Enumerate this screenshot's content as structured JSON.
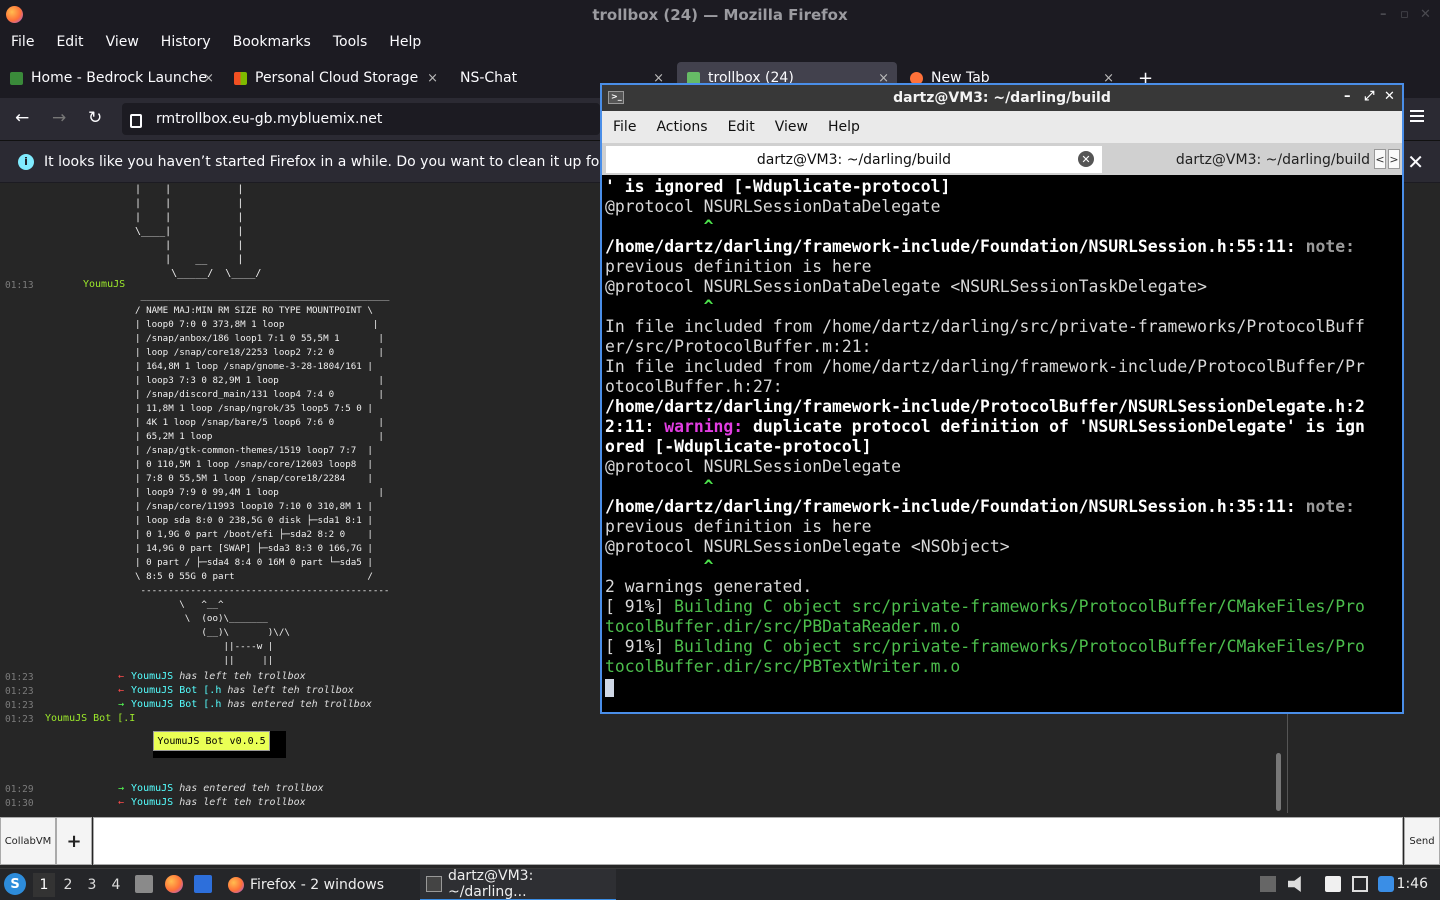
{
  "firefox": {
    "window_title": "trollbox (24) — Mozilla Firefox",
    "menu": [
      "File",
      "Edit",
      "View",
      "History",
      "Bookmarks",
      "Tools",
      "Help"
    ],
    "tabs": [
      {
        "label": "Home - Bedrock Launche",
        "close": "×"
      },
      {
        "label": "Personal Cloud Storage",
        "close": "×"
      },
      {
        "label": "NS-Chat",
        "close": "×"
      },
      {
        "label": "trollbox (24)",
        "close": "×"
      },
      {
        "label": "New Tab",
        "close": "×"
      }
    ],
    "new_tab": "+",
    "url": "rmtrollbox.eu-gb.mybluemix.net",
    "notification": "It looks like you haven’t started Firefox in a while. Do you want to clean it up for a fresh, like-new experience?",
    "notification_close": "✕",
    "nav": {
      "back": "←",
      "forward": "→",
      "reload": "↻"
    },
    "window_controls": [
      "–",
      "▫",
      "✕"
    ]
  },
  "trollbox": {
    "ascii_top": "|    |           |\n|    |           |\n|    |           |\n\\____|           |\n     |           |\n     |    __     |\n      \\_____/  \\____/",
    "ascii_df": " _____________________________________________\n/ NAME MAJ:MIN RM SIZE RO TYPE MOUNTPOINT \\\n| loop0 7:0 0 373,8M 1 loop                |\n| /snap/anbox/186 loop1 7:1 0 55,5M 1       |\n| loop /snap/core18/2253 loop2 7:2 0        |\n| 164,8M 1 loop /snap/gnome-3-28-1804/161 |\n| loop3 7:3 0 82,9M 1 loop                  |\n| /snap/discord_main/131 loop4 7:4 0        |\n| 11,8M 1 loop /snap/ngrok/35 loop5 7:5 0 |\n| 4K 1 loop /snap/bare/5 loop6 7:6 0        |\n| 65,2M 1 loop                              |\n| /snap/gtk-common-themes/1519 loop7 7:7  |\n| 0 110,5M 1 loop /snap/core/12603 loop8  |\n| 7:8 0 55,5M 1 loop /snap/core18/2284    |\n| loop9 7:9 0 99,4M 1 loop                  |\n| /snap/core/11993 loop10 7:10 0 310,8M 1 |\n| loop sda 8:0 0 238,5G 0 disk ├─sda1 8:1 |\n| 0 1,9G 0 part /boot/efi ├─sda2 8:2 0    |\n| 14,9G 0 part [SWAP] ├─sda3 8:3 0 166,7G |\n| 0 part / ├─sda4 8:4 0 16M 0 part └─sda5 |\n\\ 8:5 0 55G 0 part                        /\n ---------------------------------------------\n        \\   ^__^\n         \\  (oo)\\_______\n            (__)\\       )\\/\\\n                ||----w |\n                ||     ||",
    "first_ts": "01:13",
    "first_user": "YoumuJS",
    "events": [
      {
        "ts": "01:23",
        "arrow": "←",
        "dir": "out",
        "who": "YoumuJS",
        "text": " has left teh trollbox"
      },
      {
        "ts": "01:23",
        "arrow": "←",
        "dir": "out",
        "who": "YoumuJS Bot [.h",
        "text": " has left teh trollbox"
      },
      {
        "ts": "01:23",
        "arrow": "→",
        "dir": "in",
        "who": "YoumuJS Bot [.h",
        "text": " has entered teh trollbox"
      }
    ],
    "bot_ts": "01:23",
    "bot_user": "YoumuJS Bot [.I",
    "bot_badge": "YoumuJS Bot v0.0.5",
    "events2": [
      {
        "ts": "01:29",
        "arrow": "→",
        "dir": "in",
        "who": "YoumuJS",
        "text": " has entered teh trollbox"
      },
      {
        "ts": "01:30",
        "arrow": "←",
        "dir": "out",
        "who": "YoumuJS",
        "text": " has left teh trollbox"
      }
    ],
    "collab_button": "CollabVM",
    "plus_button": "+",
    "send_button": "Send"
  },
  "terminal": {
    "title": "dartz@VM3: ~/darling/build",
    "menu": [
      "File",
      "Actions",
      "Edit",
      "View",
      "Help"
    ],
    "tab_active": "dartz@VM3: ~/darling/build",
    "tab_second": "dartz@VM3: ~/darling/build",
    "tab_close": "✕",
    "arrows": [
      "<",
      ">"
    ],
    "controls": [
      "–",
      "⤢",
      "✕"
    ],
    "lines": {
      "l1": "' is ignored [-Wduplicate-protocol]",
      "l2": "@protocol NSURLSessionDataDelegate",
      "l3": "          ^",
      "l4a": "/home/dartz/darling/framework-include/Foundation/NSURLSession.h:55:11: ",
      "l4b": "note:",
      "l5": "previous definition is here",
      "l6": "@protocol NSURLSessionDataDelegate <NSURLSessionTaskDelegate>",
      "l7": "          ^",
      "l8": "In file included from /home/dartz/darling/src/private-frameworks/ProtocolBuff",
      "l9": "er/src/ProtocolBuffer.m:21:",
      "l10": "In file included from /home/dartz/darling/framework-include/ProtocolBuffer/Pr",
      "l11": "otocolBuffer.h:27:",
      "l12": "/home/dartz/darling/framework-include/ProtocolBuffer/NSURLSessionDelegate.h:2",
      "l13a": "2:11: ",
      "l13b": "warning:",
      "l13c": " duplicate protocol definition of 'NSURLSessionDelegate' is ign",
      "l14": "ored [-Wduplicate-protocol]",
      "l15": "@protocol NSURLSessionDelegate",
      "l16": "          ^",
      "l17a": "/home/dartz/darling/framework-include/Foundation/NSURLSession.h:35:11: ",
      "l17b": "note:",
      "l18": "previous definition is here",
      "l19": "@protocol NSURLSessionDelegate <NSObject>",
      "l20": "          ^",
      "l21": "2 warnings generated.",
      "l22a": "[ 91%] ",
      "l22b": "Building C object src/private-frameworks/ProtocolBuffer/CMakeFiles/Pro",
      "l23": "tocolBuffer.dir/src/PBDataReader.m.o",
      "l24a": "[ 91%] ",
      "l24b": "Building C object src/private-frameworks/ProtocolBuffer/CMakeFiles/Pro",
      "l25": "tocolBuffer.dir/src/PBTextWriter.m.o"
    }
  },
  "taskbar": {
    "start_label": "S",
    "workspaces": [
      "1",
      "2",
      "3",
      "4"
    ],
    "tasks": [
      {
        "label": "Firefox - 2 windows"
      },
      {
        "label": "dartz@VM3: ~/darling..."
      }
    ],
    "clock": "1:46"
  },
  "colors": {
    "accent": "#4a8ee8",
    "trollbox_user": "#9dea2b",
    "warning": "#e23de2",
    "build_green": "#4cbe4c"
  }
}
